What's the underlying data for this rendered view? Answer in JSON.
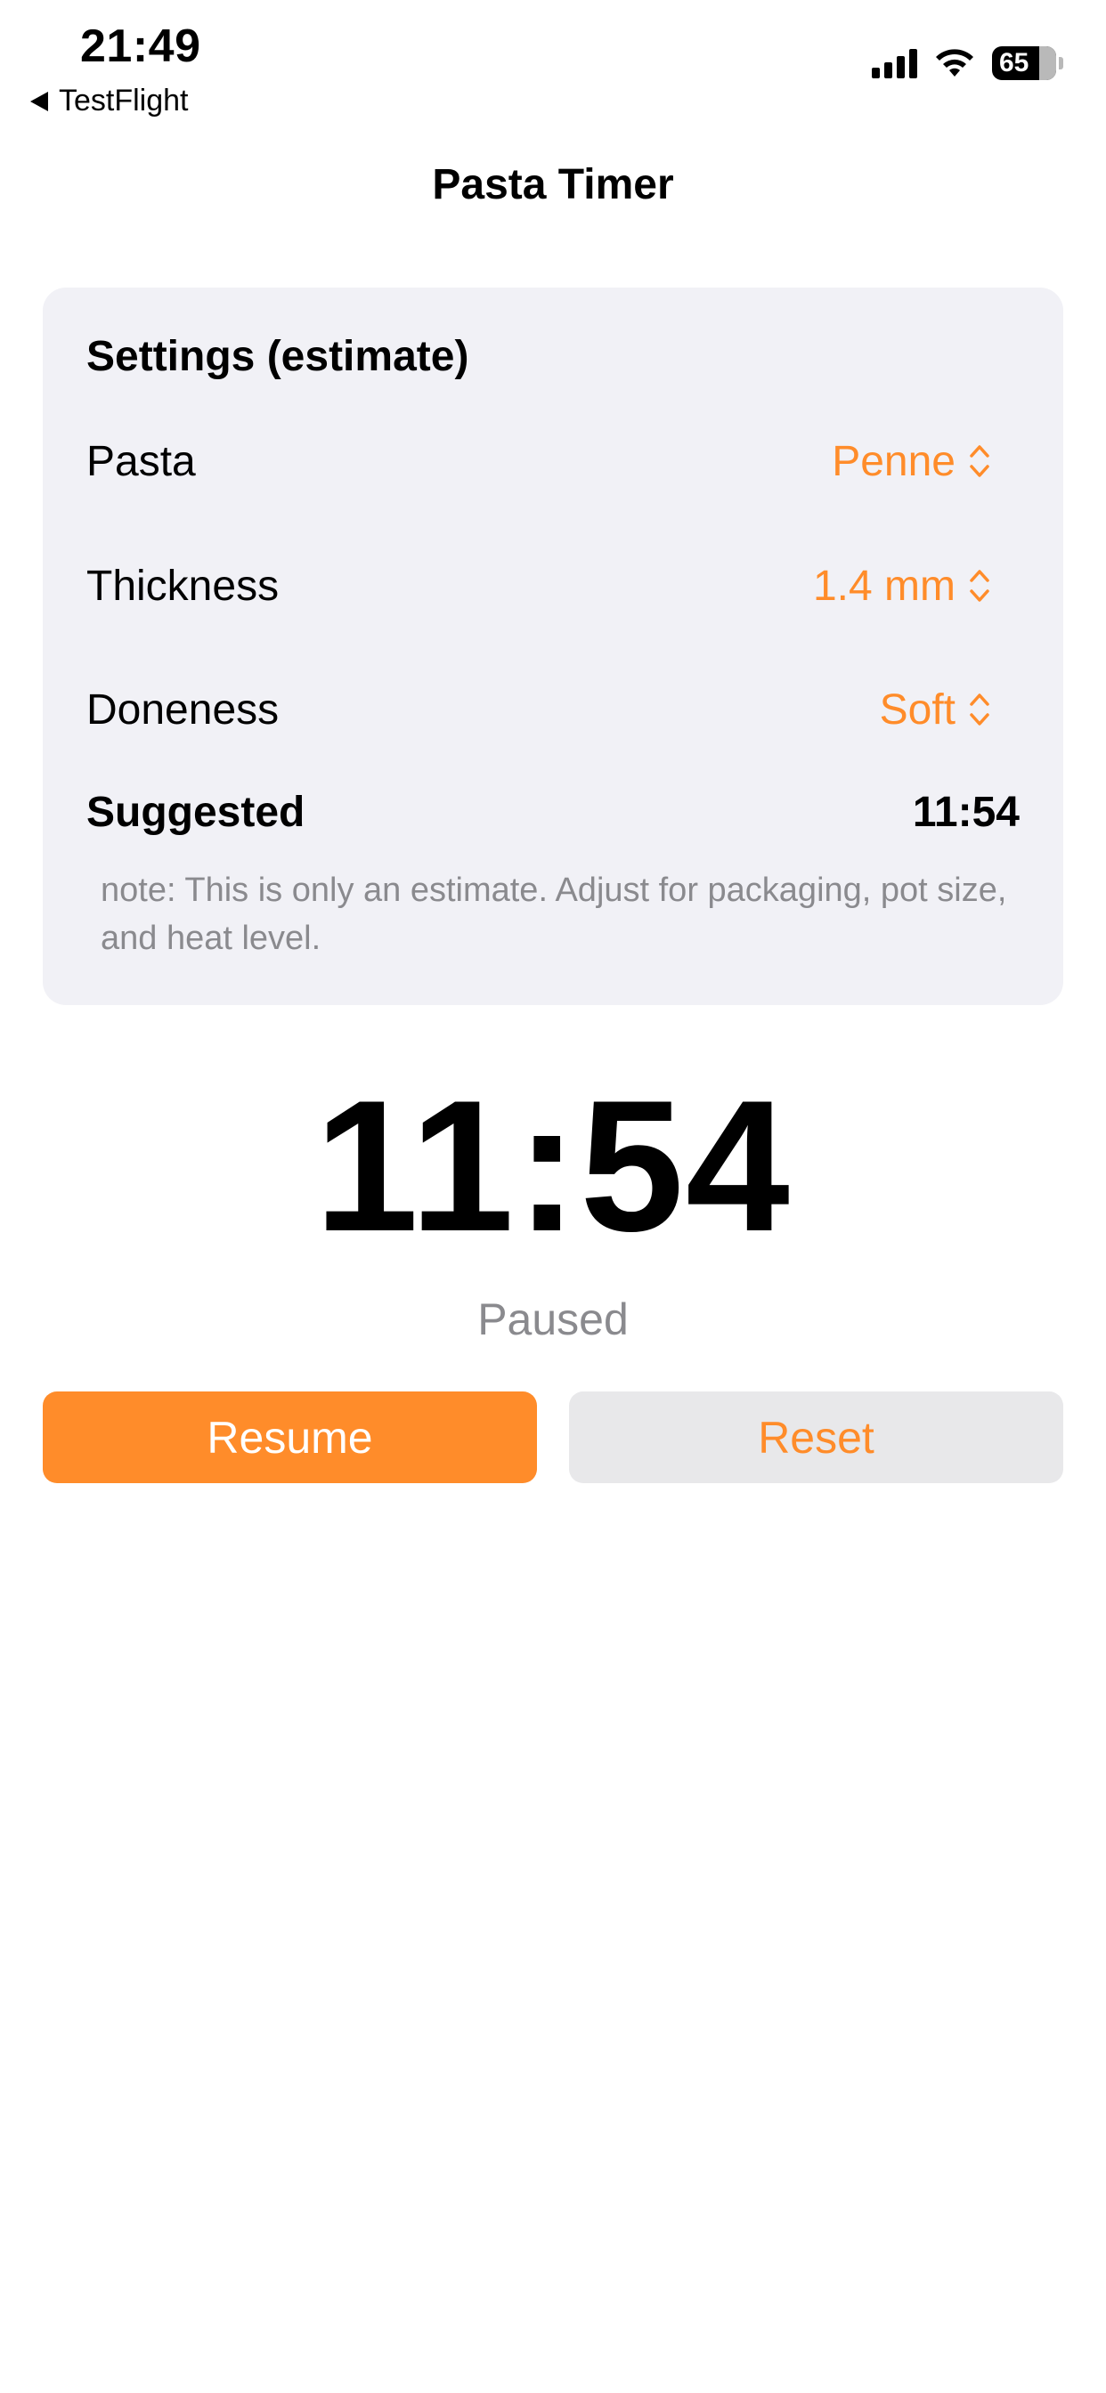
{
  "status_bar": {
    "time": "21:49",
    "back_app": "TestFlight",
    "battery_percent": "65",
    "icons": [
      "cellular-signal-icon",
      "wifi-icon",
      "battery-icon"
    ]
  },
  "nav": {
    "title": "Pasta Timer"
  },
  "settings": {
    "title": "Settings (estimate)",
    "rows": [
      {
        "label": "Pasta",
        "value": "Penne"
      },
      {
        "label": "Thickness",
        "value": "1.4 mm"
      },
      {
        "label": "Doneness",
        "value": "Soft"
      }
    ],
    "suggested": {
      "label": "Suggested",
      "value": "11:54"
    },
    "note": "note: This is only an estimate. Adjust for packaging, pot size, and heat level."
  },
  "timer": {
    "display": "11:54",
    "state": "Paused"
  },
  "actions": {
    "resume_label": "Resume",
    "reset_label": "Reset"
  },
  "colors": {
    "accent": "#ff8c2a",
    "card_bg": "#f1f1f6",
    "secondary_text": "#8a8a8e",
    "reset_bg": "#e8e8ea"
  }
}
